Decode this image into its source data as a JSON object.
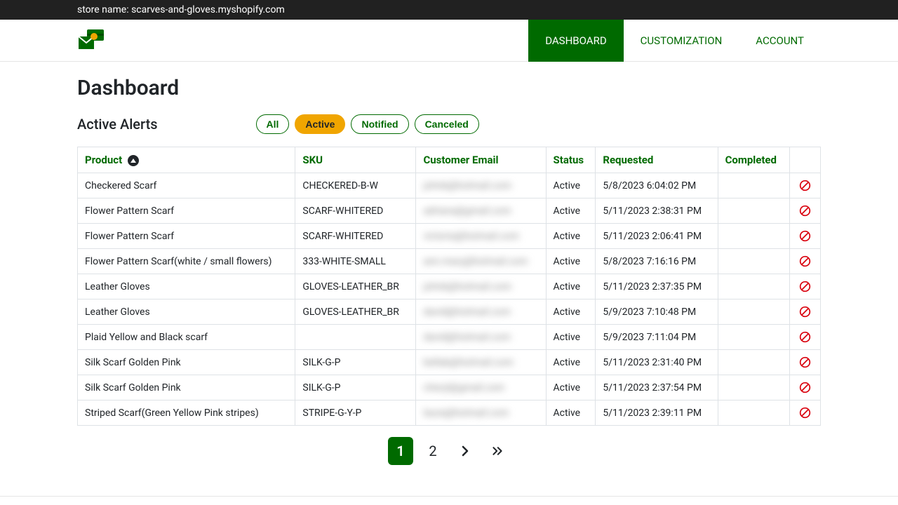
{
  "topbar": {
    "store_label": "store name: scarves-and-gloves.myshopify.com"
  },
  "nav": {
    "dashboard": "DASHBOARD",
    "customization": "CUSTOMIZATION",
    "account": "ACCOUNT"
  },
  "page": {
    "title": "Dashboard",
    "subtitle": "Active Alerts"
  },
  "filters": {
    "all": "All",
    "active": "Active",
    "notified": "Notified",
    "canceled": "Canceled"
  },
  "table": {
    "headers": {
      "product": "Product",
      "sku": "SKU",
      "email": "Customer Email",
      "status": "Status",
      "requested": "Requested",
      "completed": "Completed"
    },
    "rows": [
      {
        "product": "Checkered Scarf",
        "sku": "CHECKERED-B-W",
        "email": "johnb@hotmail.com",
        "status": "Active",
        "requested": "5/8/2023 6:04:02 PM",
        "completed": ""
      },
      {
        "product": "Flower Pattern Scarf",
        "sku": "SCARF-WHITERED",
        "email": "adriana@gmail.com",
        "status": "Active",
        "requested": "5/11/2023 2:38:31 PM",
        "completed": ""
      },
      {
        "product": "Flower Pattern Scarf",
        "sku": "SCARF-WHITERED",
        "email": "victoria@hotmail.com",
        "status": "Active",
        "requested": "5/11/2023 2:06:41 PM",
        "completed": ""
      },
      {
        "product": "Flower Pattern Scarf(white / small flowers)",
        "sku": "333-WHITE-SMALL",
        "email": "ann.mary@hotmail.com",
        "status": "Active",
        "requested": "5/8/2023 7:16:16 PM",
        "completed": ""
      },
      {
        "product": "Leather Gloves",
        "sku": "GLOVES-LEATHER_BR",
        "email": "johnb@hotmail.com",
        "status": "Active",
        "requested": "5/11/2023 2:37:35 PM",
        "completed": ""
      },
      {
        "product": "Leather Gloves",
        "sku": "GLOVES-LEATHER_BR",
        "email": "david@hotmail.com",
        "status": "Active",
        "requested": "5/9/2023 7:10:48 PM",
        "completed": ""
      },
      {
        "product": "Plaid Yellow and Black scarf",
        "sku": "",
        "email": "david@hotmail.com",
        "status": "Active",
        "requested": "5/9/2023 7:11:04 PM",
        "completed": ""
      },
      {
        "product": "Silk Scarf Golden Pink",
        "sku": "SILK-G-P",
        "email": "bellab@hotmail.com",
        "status": "Active",
        "requested": "5/11/2023 2:31:40 PM",
        "completed": ""
      },
      {
        "product": "Silk Scarf Golden Pink",
        "sku": "SILK-G-P",
        "email": "cheryl@gmail.com",
        "status": "Active",
        "requested": "5/11/2023 2:37:54 PM",
        "completed": ""
      },
      {
        "product": "Striped Scarf(Green Yellow Pink stripes)",
        "sku": "STRIPE-G-Y-P",
        "email": "laura@hotmail.com",
        "status": "Active",
        "requested": "5/11/2023 2:39:11 PM",
        "completed": ""
      }
    ]
  },
  "pagination": {
    "p1": "1",
    "p2": "2"
  }
}
